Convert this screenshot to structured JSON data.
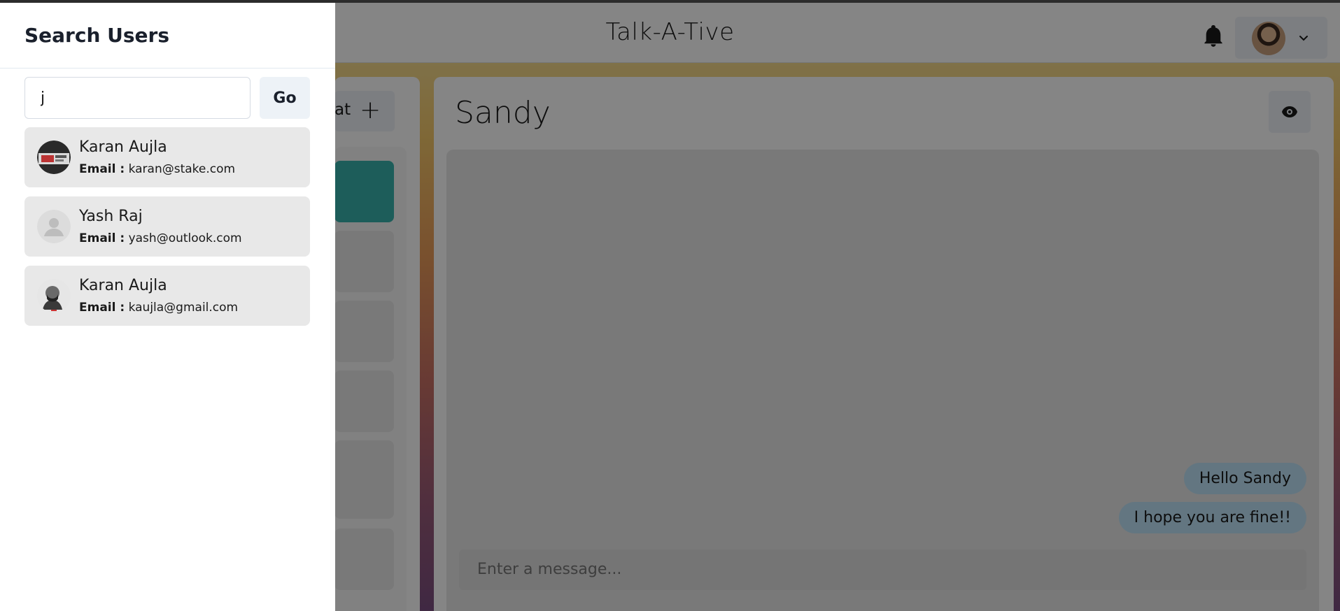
{
  "header": {
    "app_title": "Talk-A-Tive"
  },
  "chats_panel": {
    "new_chat_label": "at",
    "new_chat_icon": "plus-icon"
  },
  "chatbox": {
    "chat_name": "Sandy",
    "messages": [
      {
        "text": "Hello Sandy"
      },
      {
        "text": "I hope you are fine!!"
      }
    ],
    "input_placeholder": "Enter a message..."
  },
  "drawer": {
    "title": "Search Users",
    "search_value": "j",
    "go_label": "Go",
    "email_label": "Email :",
    "results": [
      {
        "name": "Karan Aujla",
        "email": "karan@stake.com"
      },
      {
        "name": "Yash Raj",
        "email": "yash@outlook.com"
      },
      {
        "name": "Karan Aujla",
        "email": "kaujla@gmail.com"
      }
    ]
  },
  "colors": {
    "accent_teal": "#38b2ac",
    "message_bubble": "#bee3f8",
    "result_bg": "#e8e8e8"
  }
}
